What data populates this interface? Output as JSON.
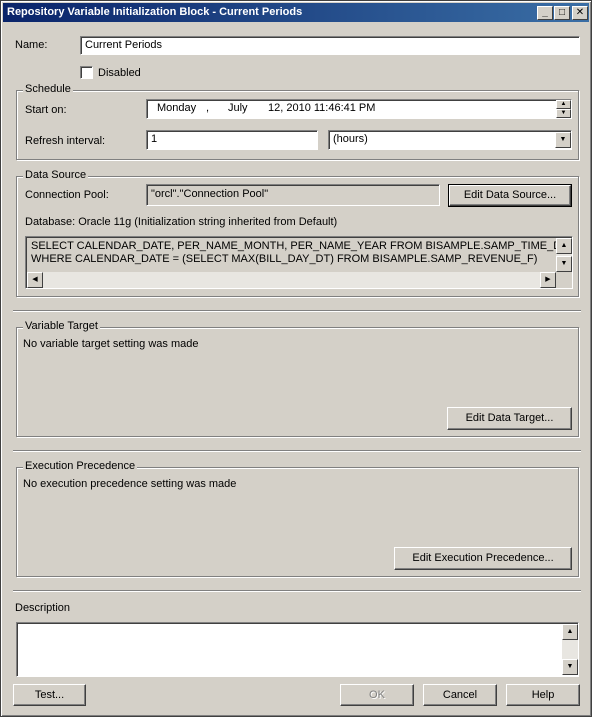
{
  "window": {
    "title": "Repository Variable Initialization Block - Current Periods",
    "controls": {
      "minimize": "_",
      "maximize": "□",
      "close": "✕"
    }
  },
  "name": {
    "label": "Name:",
    "value": "Current Periods"
  },
  "disabled": {
    "label": "Disabled",
    "checked": false
  },
  "schedule": {
    "title": "Schedule",
    "start_on_label": "Start on:",
    "start_day": "Monday",
    "start_sep": ",",
    "start_month": "July",
    "start_rest": "12, 2010 11:46:41 PM",
    "refresh_label": "Refresh interval:",
    "refresh_value": "1",
    "refresh_unit": "(hours)"
  },
  "data_source": {
    "title": "Data Source",
    "pool_label": "Connection Pool:",
    "pool_value": "\"orcl\".\"Connection Pool\"",
    "edit_button": "Edit Data Source...",
    "database_text": "Database: Oracle 11g (Initialization string inherited from Default)",
    "sql_line1": "SELECT CALENDAR_DATE, PER_NAME_MONTH, PER_NAME_YEAR FROM BISAMPLE.SAMP_TIME_DAY_D",
    "sql_line2": "WHERE CALENDAR_DATE = (SELECT MAX(BILL_DAY_DT) FROM BISAMPLE.SAMP_REVENUE_F)"
  },
  "variable_target": {
    "title": "Variable Target",
    "text": "No variable target setting was made",
    "edit_button": "Edit Data Target..."
  },
  "execution_precedence": {
    "title": "Execution Precedence",
    "text": "No execution precedence setting was made",
    "edit_button": "Edit Execution Precedence..."
  },
  "description": {
    "label": "Description",
    "value": ""
  },
  "footer": {
    "test": "Test...",
    "ok": "OK",
    "cancel": "Cancel",
    "help": "Help"
  }
}
